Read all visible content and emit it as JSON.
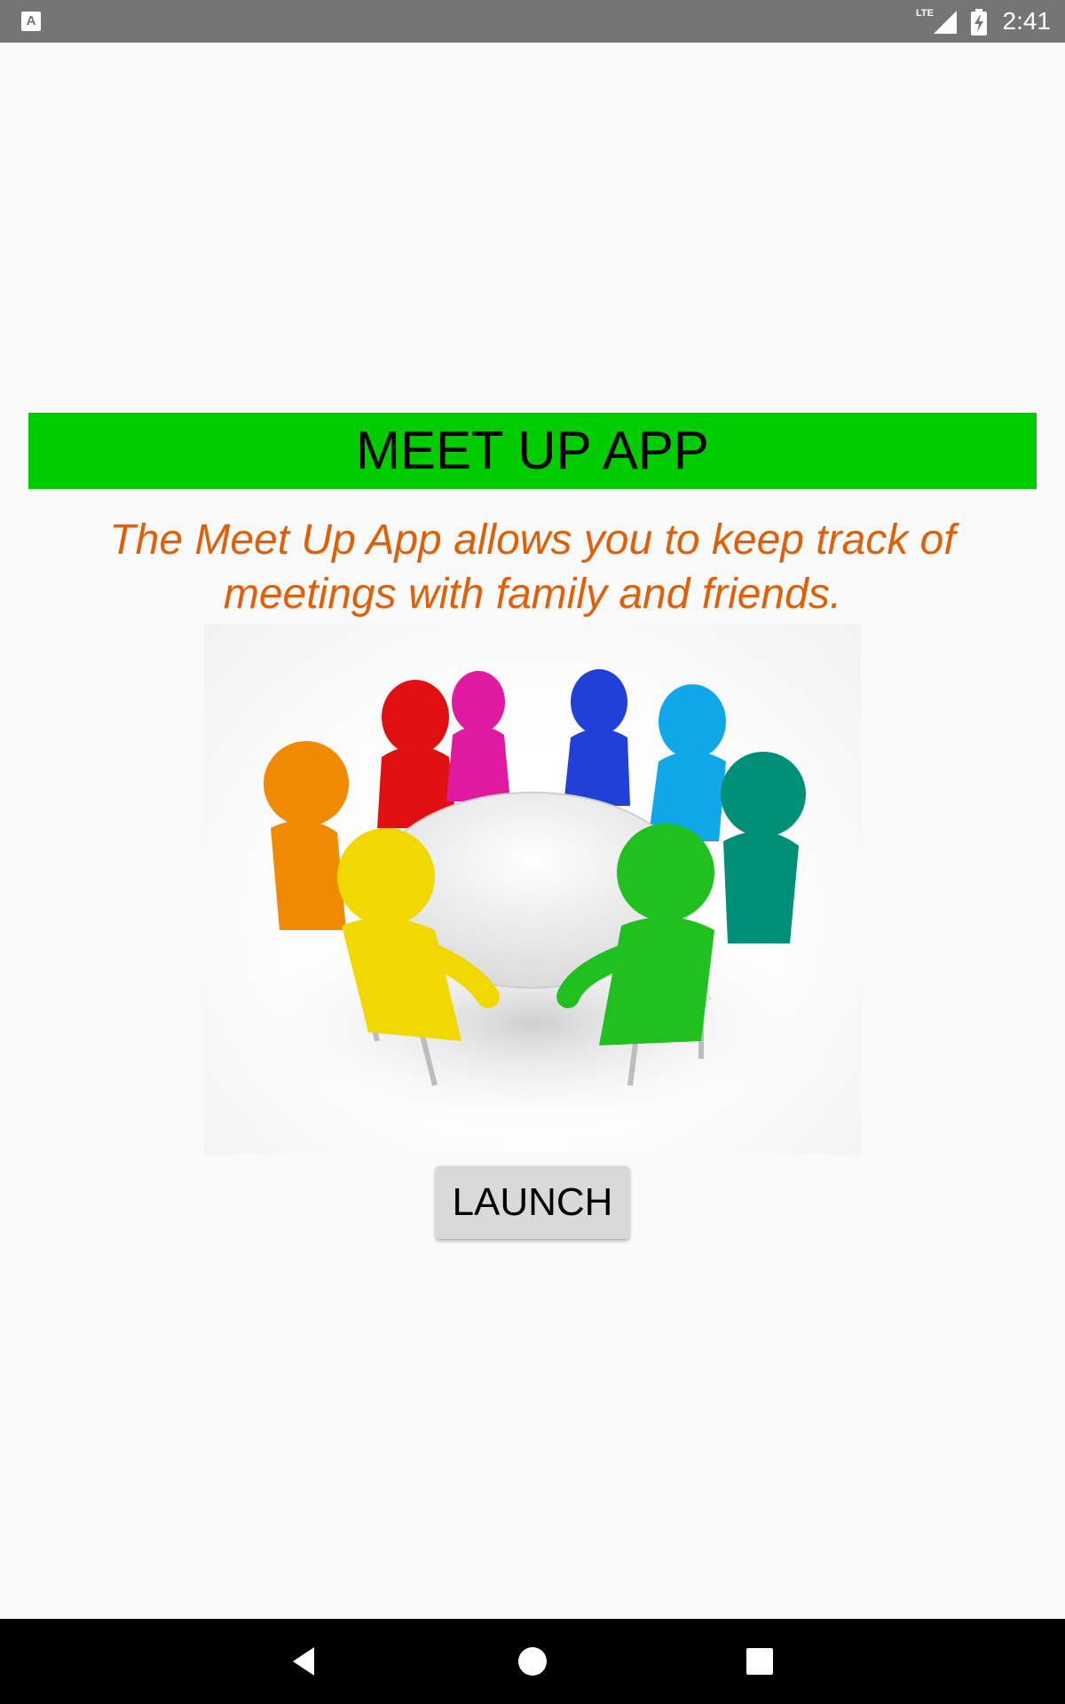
{
  "status_bar": {
    "time": "2:41",
    "network": "LTE",
    "icons": [
      "app-notification-icon",
      "signal-icon",
      "battery-charging-icon"
    ]
  },
  "app": {
    "title": "MEET UP APP",
    "description": "The Meet Up App allows you to keep track of meetings with family and friends.",
    "launch_label": "LAUNCH"
  },
  "illustration": {
    "icon": "people-round-table-icon",
    "figure_colors": [
      "#f08a00",
      "#e01010",
      "#e01aa0",
      "#2040d8",
      "#10a8e8",
      "#00907a",
      "#f0d800",
      "#20c020"
    ]
  },
  "colors": {
    "title_background": "#00cc00",
    "description_text": "#e0600a",
    "button_background": "#d9d9d9",
    "status_bar": "#757575",
    "nav_bar": "#000000"
  },
  "nav_bar": {
    "icons": [
      "back-icon",
      "home-icon",
      "recents-icon"
    ]
  }
}
